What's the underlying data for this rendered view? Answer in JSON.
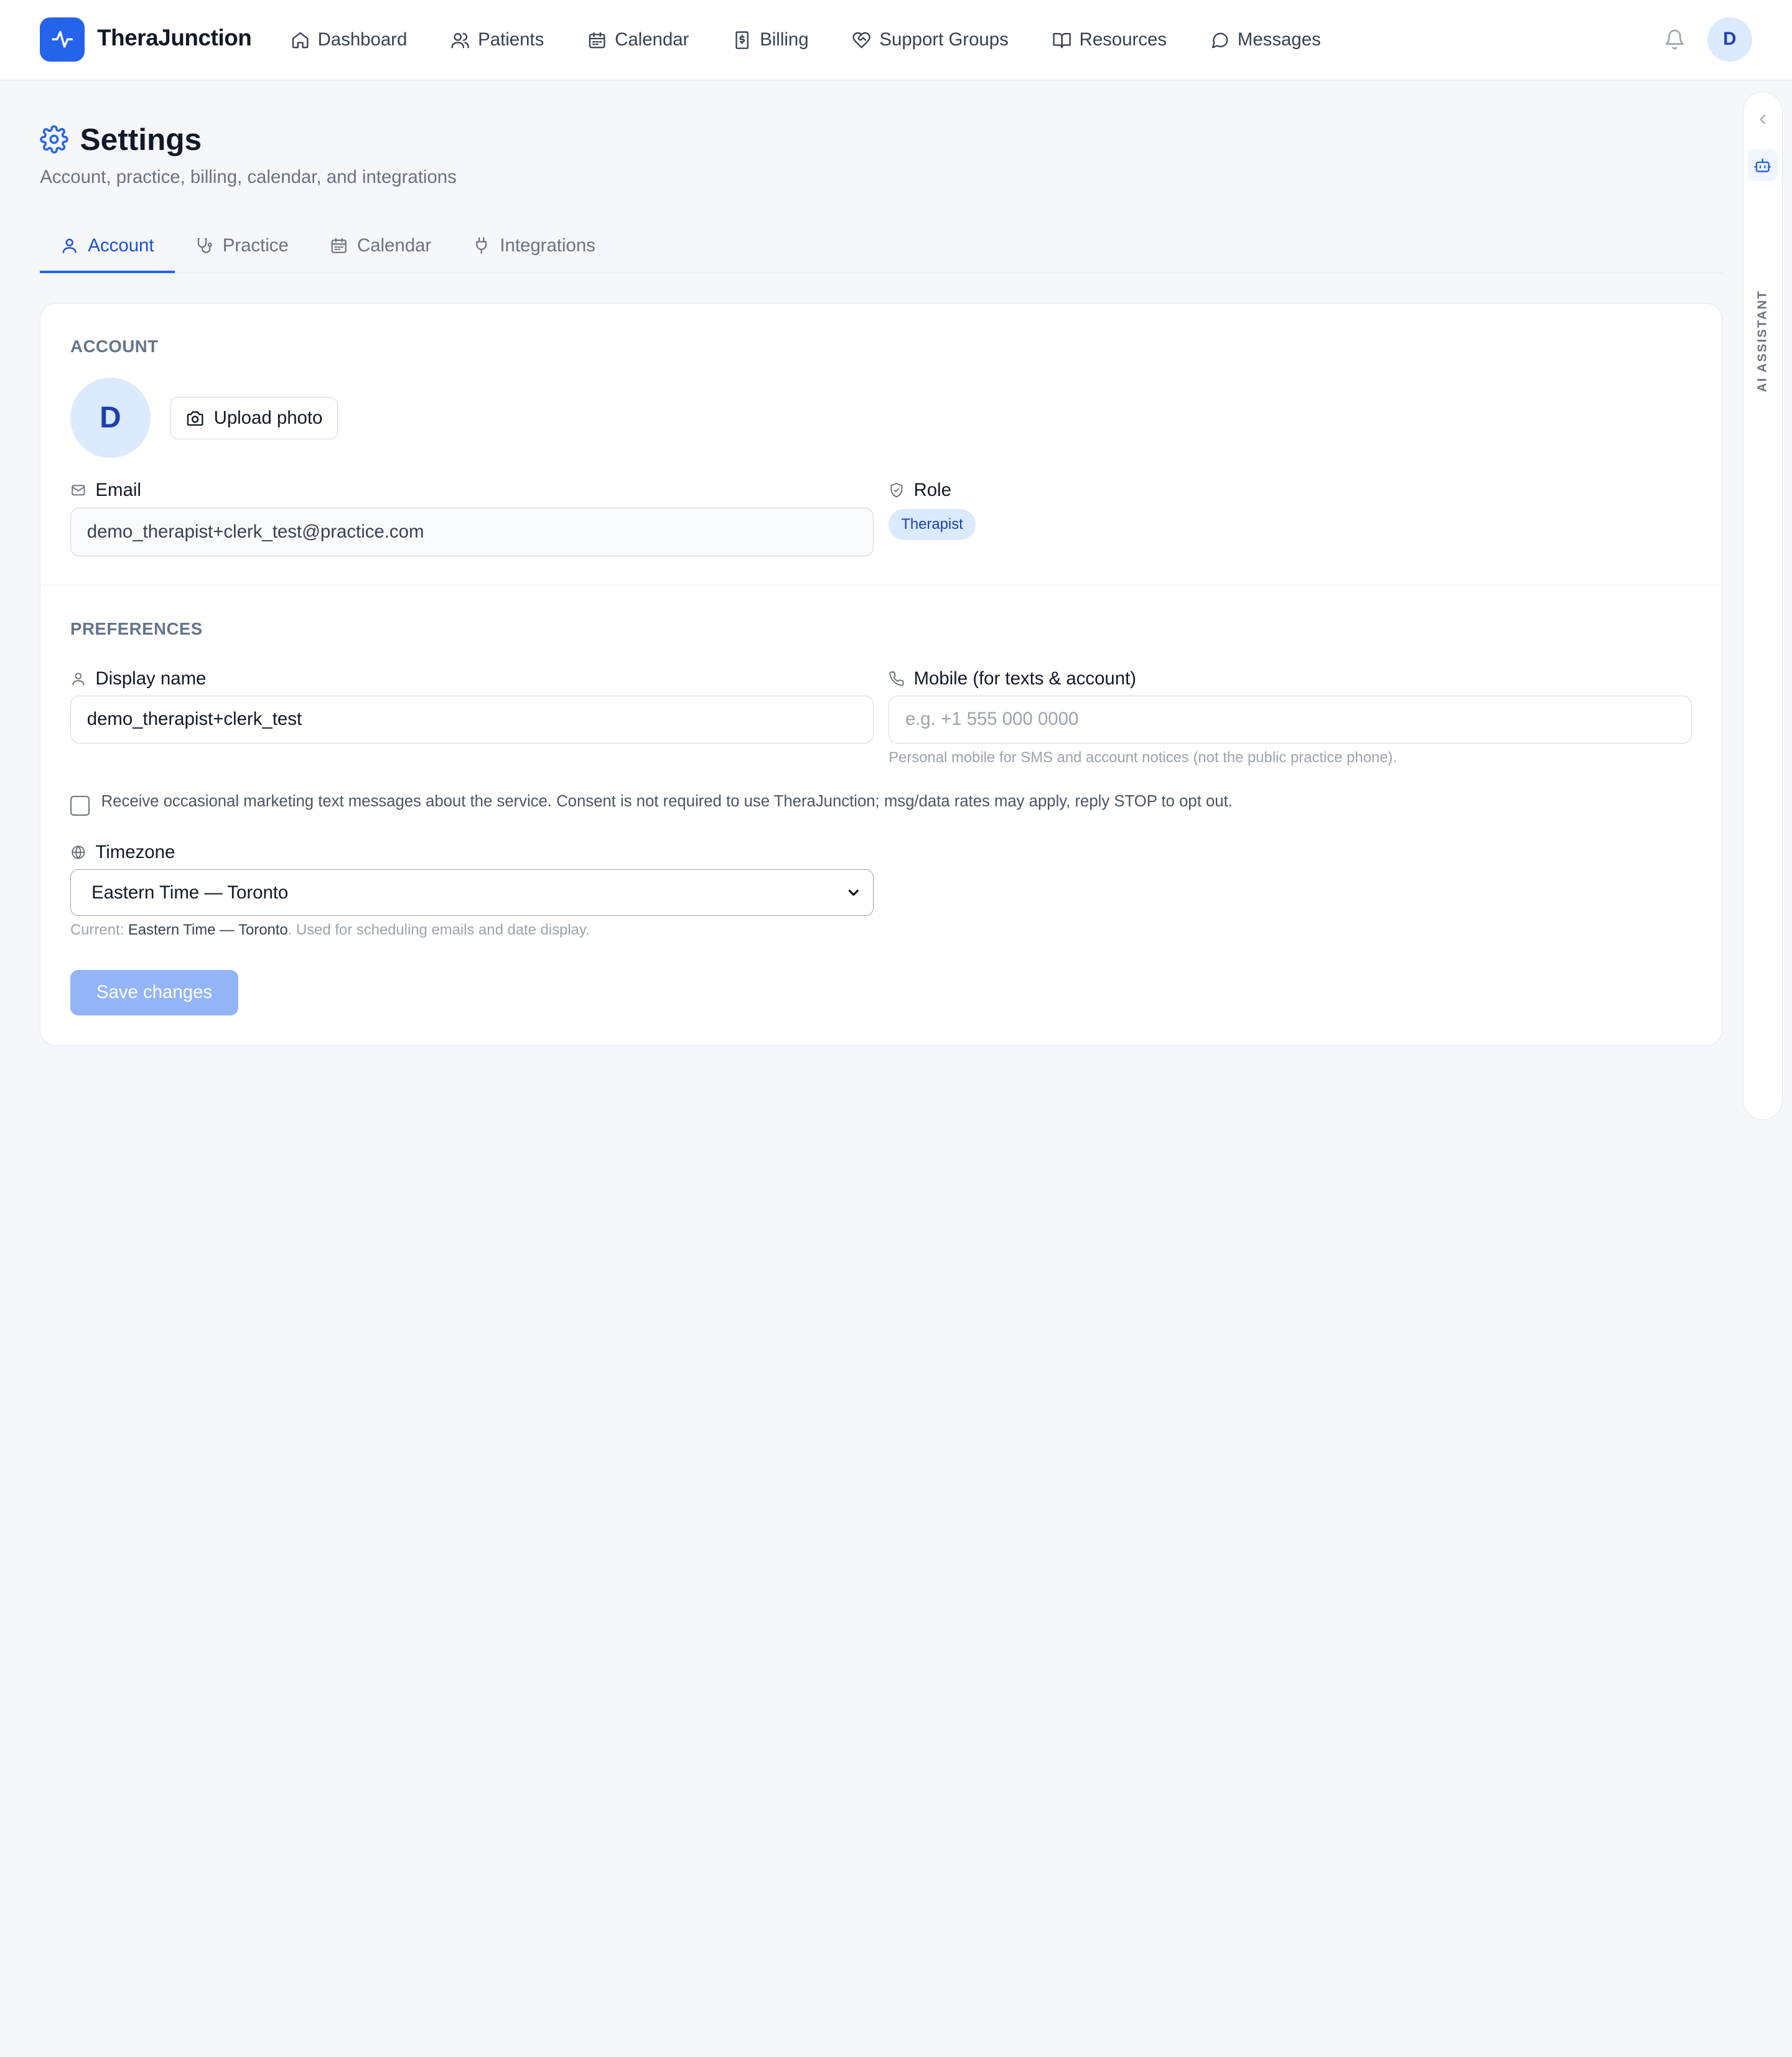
{
  "app": {
    "brand": "TheraJunction",
    "nav": [
      {
        "label": "Dashboard",
        "icon": "home-icon"
      },
      {
        "label": "Patients",
        "icon": "users-icon"
      },
      {
        "label": "Calendar",
        "icon": "calendar-icon"
      },
      {
        "label": "Billing",
        "icon": "receipt-icon"
      },
      {
        "label": "Support Groups",
        "icon": "heart-handshake-icon"
      },
      {
        "label": "Resources",
        "icon": "book-open-icon"
      },
      {
        "label": "Messages",
        "icon": "message-circle-icon"
      }
    ],
    "user_initial": "D"
  },
  "rail": {
    "label": "AI ASSISTANT"
  },
  "page": {
    "title": "Settings",
    "subtitle": "Account, practice, billing, calendar, and integrations"
  },
  "tabs": [
    {
      "label": "Account",
      "active": true
    },
    {
      "label": "Practice",
      "active": false
    },
    {
      "label": "Calendar",
      "active": false
    },
    {
      "label": "Integrations",
      "active": false
    }
  ],
  "account": {
    "section_label": "ACCOUNT",
    "avatar_initial": "D",
    "upload_label": "Upload photo",
    "email_label": "Email",
    "email_value": "demo_therapist+clerk_test@practice.com",
    "role_label": "Role",
    "role_value": "Therapist"
  },
  "preferences": {
    "section_label": "PREFERENCES",
    "display_name_label": "Display name",
    "display_name_value": "demo_therapist+clerk_test",
    "mobile_label": "Mobile (for texts & account)",
    "mobile_placeholder": "e.g. +1 555 000 0000",
    "mobile_help": "Personal mobile for SMS and account notices (not the public practice phone).",
    "consent_text": "Receive occasional marketing text messages about the service. Consent is not required to use TheraJunction; msg/data rates may apply, reply STOP to opt out.",
    "consent_checked": false,
    "timezone_label": "Timezone",
    "timezone_value": "Eastern Time — Toronto",
    "timezone_help_prefix": "Current: ",
    "timezone_help_current": "Eastern Time — Toronto",
    "timezone_help_suffix": ". Used for scheduling emails and date display.",
    "save_label": "Save changes"
  },
  "colors": {
    "accent": "#2563eb",
    "save_disabled": "#93b4f7",
    "badge_bg": "#dbeafe"
  }
}
